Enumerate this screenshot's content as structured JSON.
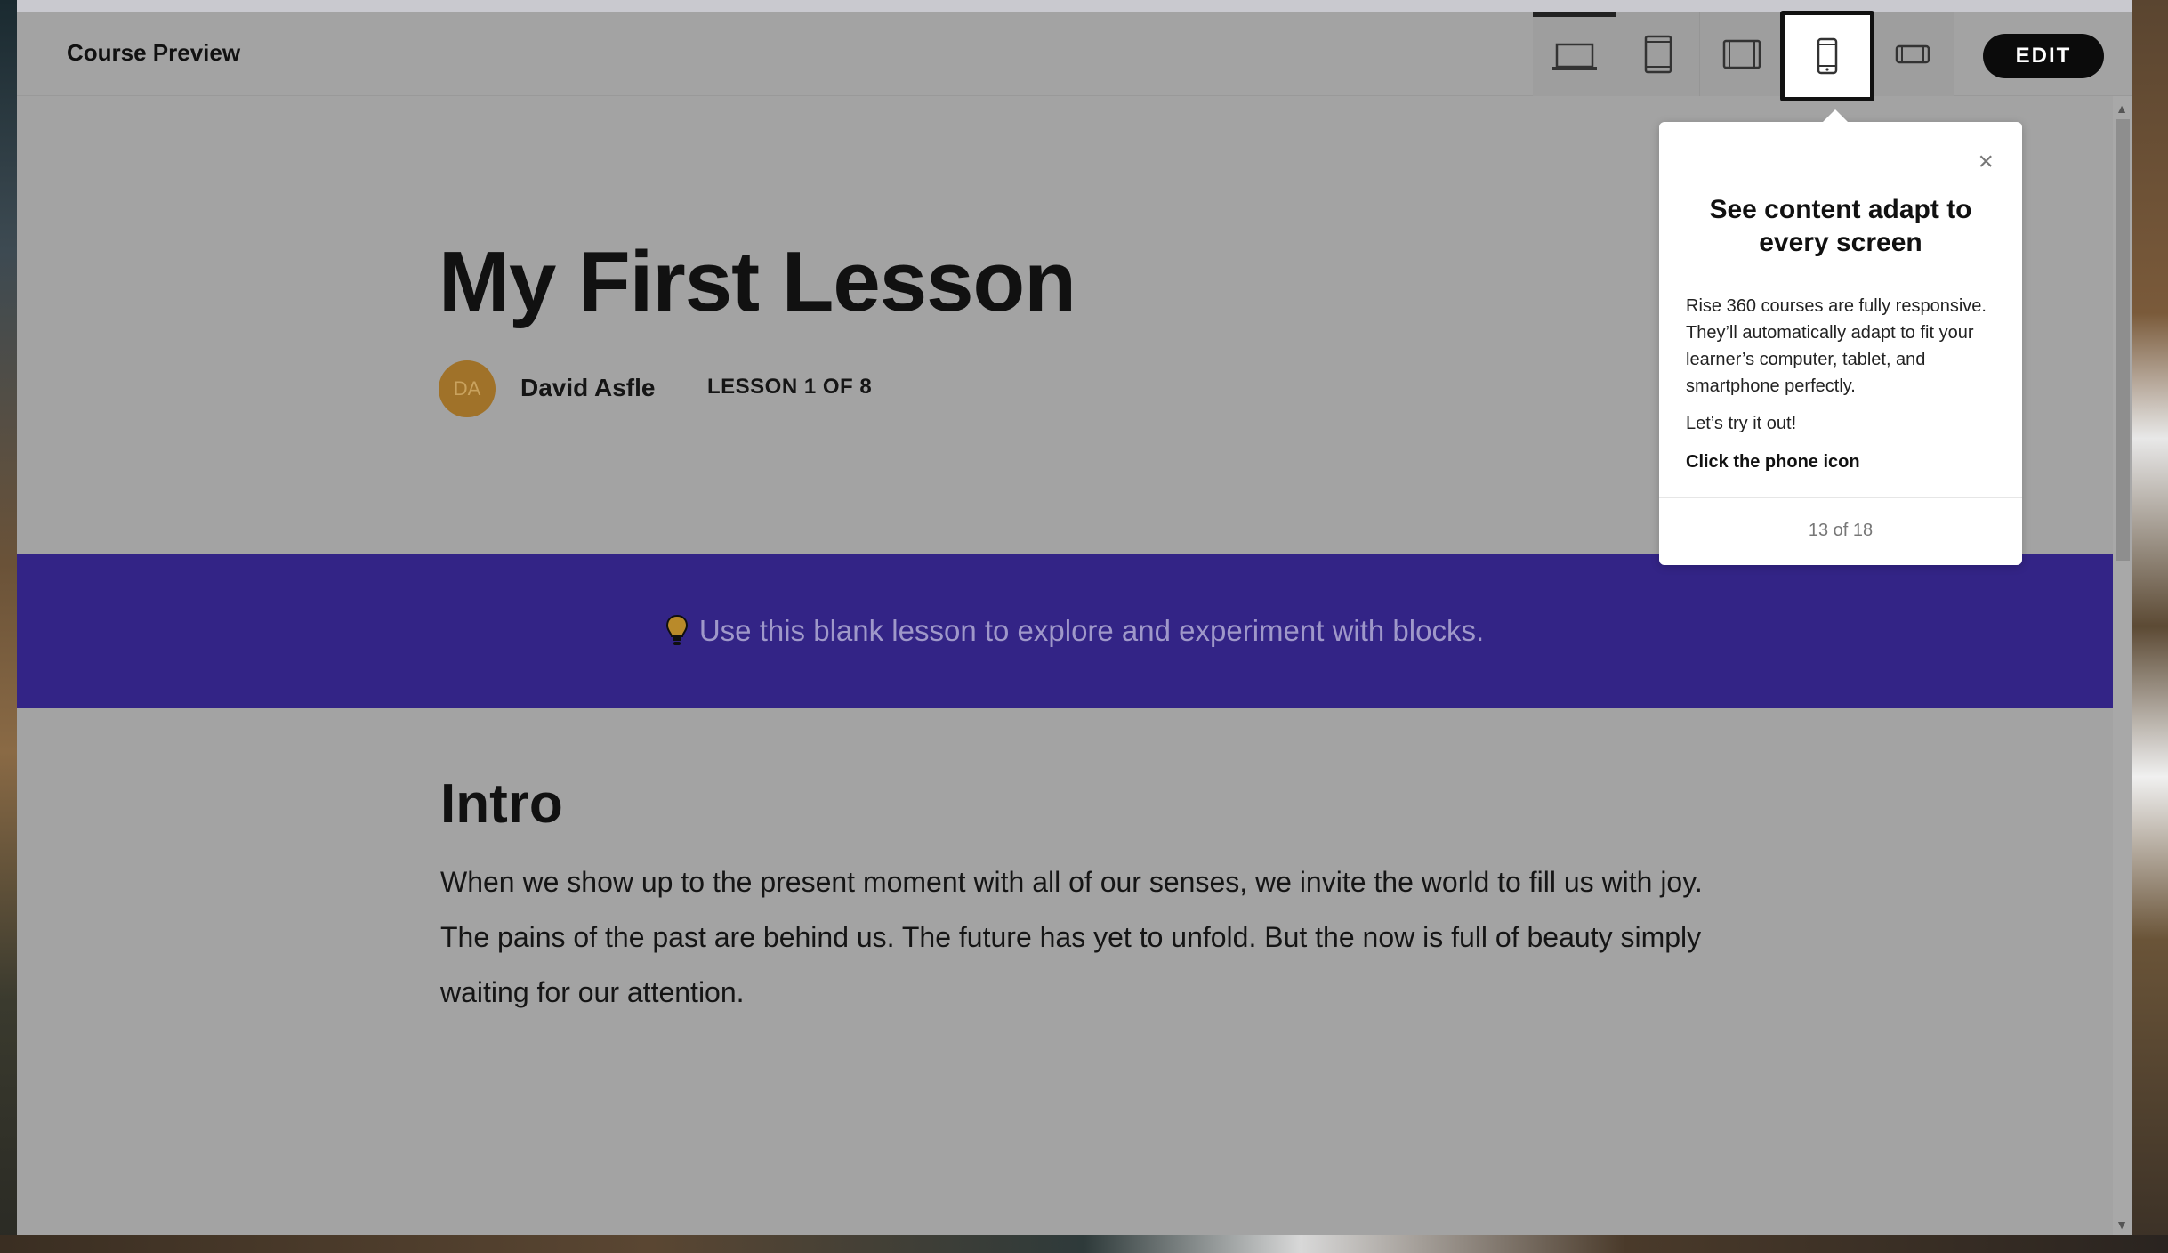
{
  "header": {
    "title": "Course Preview",
    "edit_label": "EDIT",
    "device_icons": [
      "laptop-icon",
      "tablet-portrait-icon",
      "tablet-landscape-icon",
      "phone-portrait-icon",
      "phone-landscape-icon"
    ],
    "active_device": "phone-portrait-icon"
  },
  "lesson": {
    "title": "My First Lesson",
    "avatar_initials": "DA",
    "author": "David Asfle",
    "count": "LESSON 1 OF 8"
  },
  "banner": {
    "text": "Use this blank lesson to explore and experiment with blocks.",
    "icon": "lightbulb-icon",
    "color": "#332486"
  },
  "intro": {
    "heading": "Intro",
    "body": "When we show up to the present moment with all of our senses, we invite the world to fill us with joy. The pains of the past are behind us. The future has yet to unfold. But the now is full of beauty simply waiting for our attention."
  },
  "popover": {
    "title": "See content adapt to every screen",
    "body1": "Rise 360 courses are fully responsive. They’ll automatically adapt to fit your learner’s computer, tablet, and smartphone perfectly.",
    "body2": "Let’s try it out!",
    "cta": "Click the phone icon",
    "step": "13 of 18",
    "close_symbol": "×"
  },
  "colors": {
    "overlay": "#a3a3a3",
    "avatar": "#a07229",
    "edit_button": "#0b0b0b"
  }
}
